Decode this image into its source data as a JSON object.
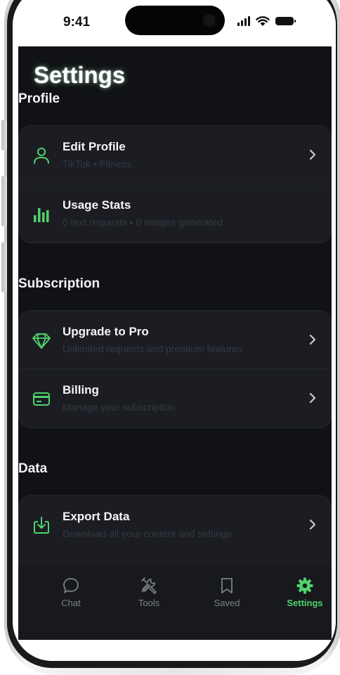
{
  "status": {
    "time": "9:41"
  },
  "page": {
    "title": "Settings"
  },
  "sections": {
    "profile": {
      "label": "Profile",
      "rows": [
        {
          "title": "Edit Profile",
          "subtitle": "TikTok • Fitness",
          "icon": "user-icon"
        },
        {
          "title": "Usage Stats",
          "subtitle": "0 text requests • 0 images generated",
          "icon": "bar-chart-icon"
        }
      ]
    },
    "subscription": {
      "label": "Subscription",
      "rows": [
        {
          "title": "Upgrade to Pro",
          "subtitle": "Unlimited requests and premium features",
          "icon": "diamond-icon"
        },
        {
          "title": "Billing",
          "subtitle": "Manage your subscription",
          "icon": "credit-card-icon"
        }
      ]
    },
    "data": {
      "label": "Data",
      "rows": [
        {
          "title": "Export Data",
          "subtitle": "Download all your content and settings",
          "icon": "download-icon"
        }
      ]
    }
  },
  "tabbar": {
    "tabs": [
      {
        "label": "Chat",
        "icon": "chat-bubble-icon",
        "active": false
      },
      {
        "label": "Tools",
        "icon": "tools-icon",
        "active": false
      },
      {
        "label": "Saved",
        "icon": "bookmark-icon",
        "active": false
      },
      {
        "label": "Settings",
        "icon": "gear-icon",
        "active": true
      }
    ]
  },
  "colors": {
    "accent": "#4fd26b",
    "background": "#101216",
    "card": "#1b1d22",
    "tab_inactive": "#7c8088"
  }
}
